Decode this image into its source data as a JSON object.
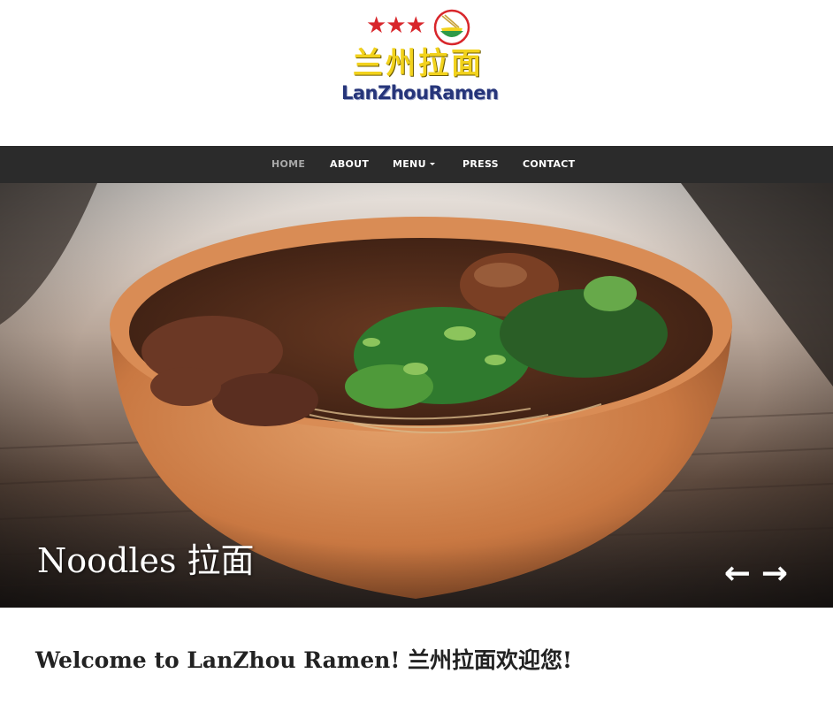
{
  "logo": {
    "stars": "★★★",
    "chinese_name": "兰州拉面",
    "english_name": "LanZhouRamen"
  },
  "nav": {
    "items": [
      {
        "label": "HOME",
        "active": true
      },
      {
        "label": "ABOUT",
        "active": false
      },
      {
        "label": "MENU",
        "active": false,
        "has_dropdown": true
      },
      {
        "label": "PRESS",
        "active": false
      },
      {
        "label": "CONTACT",
        "active": false
      }
    ]
  },
  "hero": {
    "caption": "Noodles 拉面",
    "prev_arrow": "←",
    "next_arrow": "→"
  },
  "welcome": {
    "text": "Welcome to LanZhou Ramen! 兰州拉面欢迎您!"
  },
  "colors": {
    "nav_background": "#2b2b2b",
    "nav_active": "#a8a8a8",
    "logo_star_red": "#d8262b",
    "logo_yellow": "#f2d21c",
    "logo_blue": "#26357a"
  }
}
